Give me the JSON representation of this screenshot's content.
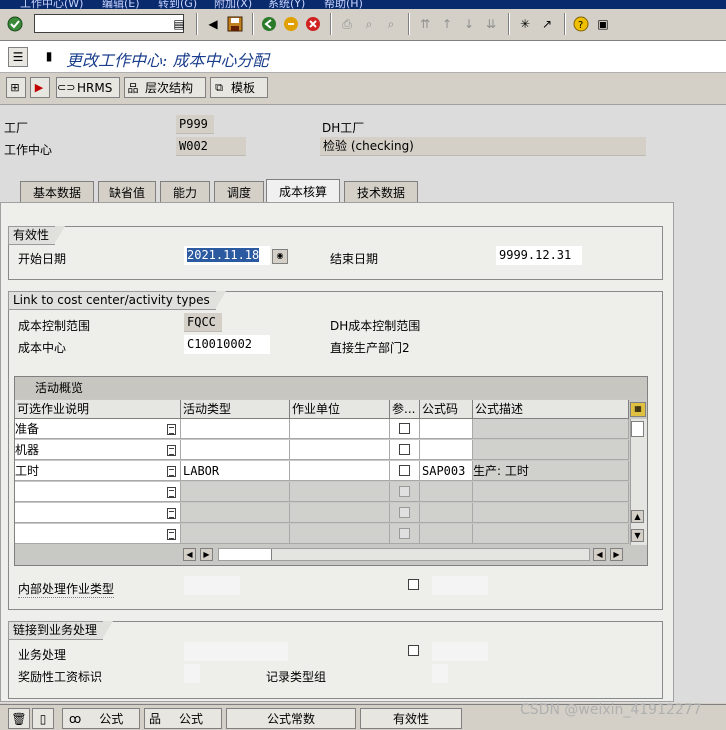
{
  "menu": [
    "工作中心(W)",
    "编辑(E)",
    "转到(G)",
    "附加(X)",
    "系统(Y)",
    "帮助(H)"
  ],
  "screen_title": "更改工作中心: 成本中心分配",
  "app_toolbar": {
    "hrms": "HRMS",
    "hierarchy": "层次结构",
    "template": "模板"
  },
  "header": {
    "plant_label": "工厂",
    "plant_value": "P999",
    "plant_desc": "DH工厂",
    "wc_label": "工作中心",
    "wc_value": "W002",
    "wc_desc": "检验 (checking)"
  },
  "tabs": [
    {
      "label": "基本数据",
      "active": false
    },
    {
      "label": "缺省值",
      "active": false
    },
    {
      "label": "能力",
      "active": false
    },
    {
      "label": "调度",
      "active": false
    },
    {
      "label": "成本核算",
      "active": true
    },
    {
      "label": "技术数据",
      "active": false
    }
  ],
  "validity": {
    "title": "有效性",
    "start_label": "开始日期",
    "start_value": "2021.11.18",
    "end_label": "结束日期",
    "end_value": "9999.12.31"
  },
  "link": {
    "title": "Link to cost center/activity types",
    "ca_label": "成本控制范围",
    "ca_value": "FQCC",
    "ca_desc": "DH成本控制范围",
    "cc_label": "成本中心",
    "cc_value": "C10010002",
    "cc_desc": "直接生产部门2"
  },
  "activity": {
    "caption": "活动概览",
    "columns": [
      "可选作业说明",
      "活动类型",
      "作业单位",
      "参...",
      "公式码",
      "公式描述"
    ],
    "rows": [
      {
        "desc": "准备",
        "type": "",
        "unit": "",
        "formula": "",
        "formula_desc": ""
      },
      {
        "desc": "机器",
        "type": "",
        "unit": "",
        "formula": "",
        "formula_desc": ""
      },
      {
        "desc": "工时",
        "type": "LABOR",
        "unit": "",
        "formula": "SAP003",
        "formula_desc": "生产: 工时"
      },
      {
        "desc": "",
        "type": "",
        "unit": "",
        "formula": "",
        "formula_desc": ""
      },
      {
        "desc": "",
        "type": "",
        "unit": "",
        "formula": "",
        "formula_desc": ""
      },
      {
        "desc": "",
        "type": "",
        "unit": "",
        "formula": "",
        "formula_desc": ""
      }
    ],
    "internal_label": "内部处理作业类型"
  },
  "business": {
    "title": "链接到业务处理",
    "bp_label": "业务处理",
    "incentive_label": "奖励性工资标识",
    "record_label": "记录类型组"
  },
  "bottom_buttons": {
    "formula1": "公式",
    "formula2": "公式",
    "constants": "公式常数",
    "validity": "有效性"
  },
  "watermark": "CSDN @weixin_41912277",
  "colors": {
    "title_blue": "#1a3e8c",
    "menu_bg": "#0a2a6e",
    "panel_bg": "#eeeeea"
  }
}
